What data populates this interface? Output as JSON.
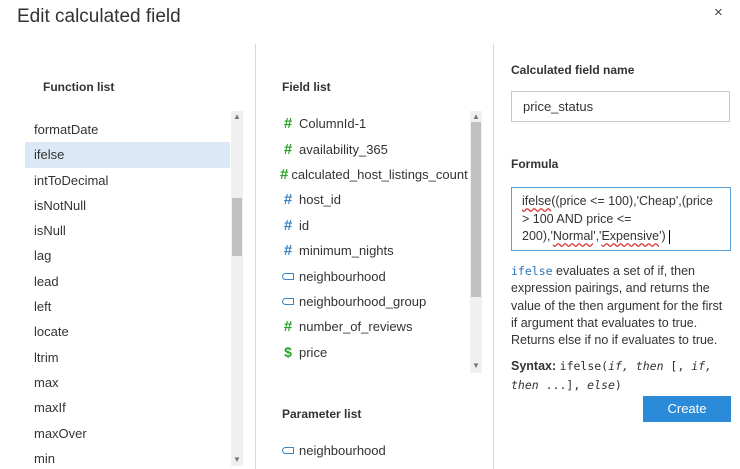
{
  "dialog": {
    "title": "Edit calculated field",
    "close_label": "×"
  },
  "function_list": {
    "heading": "Function list",
    "selected": "ifelse",
    "items": [
      "formatDate",
      "ifelse",
      "intToDecimal",
      "isNotNull",
      "isNull",
      "lag",
      "lead",
      "left",
      "locate",
      "ltrim",
      "max",
      "maxIf",
      "maxOver",
      "min"
    ]
  },
  "field_list": {
    "heading": "Field list",
    "items": [
      {
        "label": "ColumnId-1",
        "icon": "hash-green"
      },
      {
        "label": "availability_365",
        "icon": "hash-green"
      },
      {
        "label": "calculated_host_listings_count",
        "icon": "hash-green"
      },
      {
        "label": "host_id",
        "icon": "hash-blue"
      },
      {
        "label": "id",
        "icon": "hash-blue"
      },
      {
        "label": "minimum_nights",
        "icon": "hash-blue"
      },
      {
        "label": "neighbourhood",
        "icon": "string-tag"
      },
      {
        "label": "neighbourhood_group",
        "icon": "string-tag"
      },
      {
        "label": "number_of_reviews",
        "icon": "hash-green"
      },
      {
        "label": "price",
        "icon": "dollar"
      }
    ]
  },
  "parameter_list": {
    "heading": "Parameter list",
    "items": [
      "neighbourhood"
    ]
  },
  "calculated_field": {
    "name_label": "Calculated field name",
    "name_value": "price_status",
    "formula_label": "Formula",
    "formula_parts": {
      "a": "ifelse",
      "b": "((price <= 100),'Cheap',(price > 100 AND price <= 200),'",
      "c": "Normal",
      "d": "','",
      "e": "Expensive",
      "f": "')"
    }
  },
  "description": {
    "fn": "ifelse",
    "text": " evaluates a set of if, then expression pairings, and returns the value of the then argument for the first if argument that evaluates to true. Returns else if no if evaluates to true."
  },
  "syntax": {
    "label": "Syntax:",
    "code_a": "ifelse(",
    "code_b": "if, then",
    "code_c": " [, ",
    "code_d": "if, then",
    "code_e": " ...], ",
    "code_f": "else",
    "code_g": ")"
  },
  "actions": {
    "create_label": "Create"
  },
  "colors": {
    "accent": "#2b8bd9",
    "selected_row": "#dbe9f6",
    "numeric_icon": "#2aa42a",
    "id_icon": "#3a84c5"
  }
}
